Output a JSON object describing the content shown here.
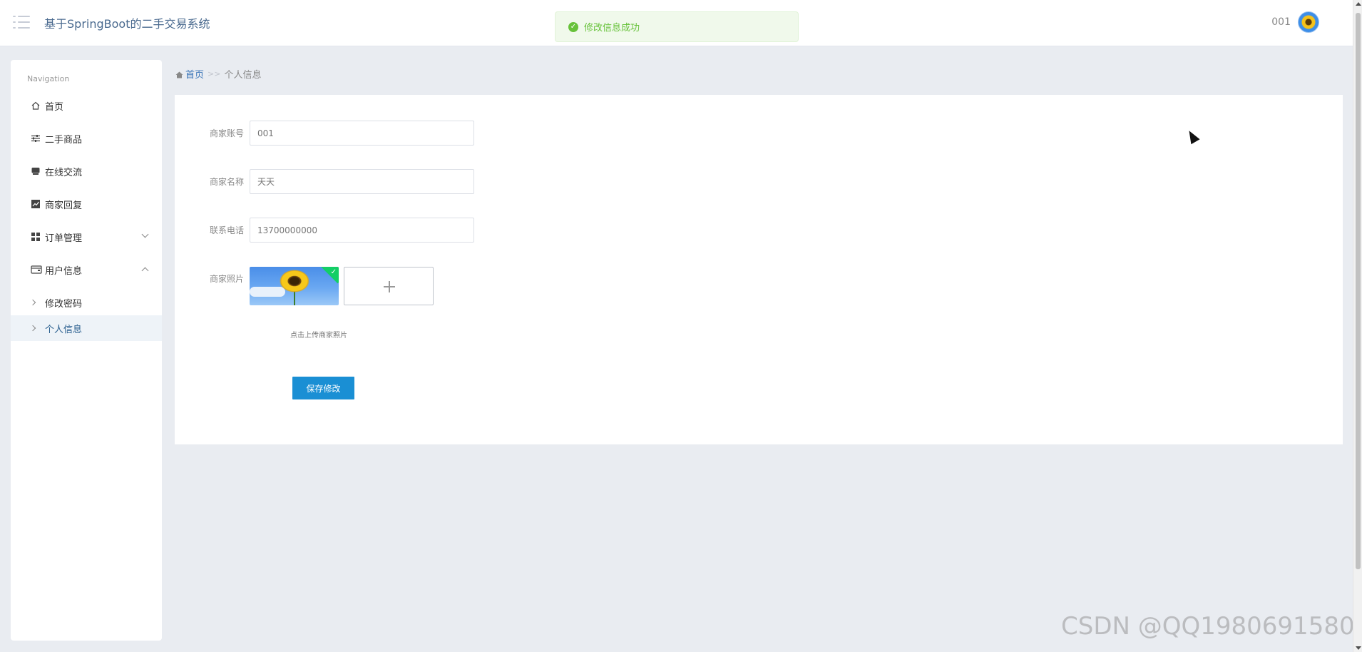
{
  "header": {
    "title": "基于SpringBoot的二手交易系统",
    "user_name": "001"
  },
  "toast": {
    "message": "修改信息成功",
    "color": "#67c23a"
  },
  "sidebar": {
    "heading": "Navigation",
    "items": [
      {
        "label": "首页",
        "icon": "home-icon"
      },
      {
        "label": "二手商品",
        "icon": "sliders-icon"
      },
      {
        "label": "在线交流",
        "icon": "chat-icon"
      },
      {
        "label": "商家回复",
        "icon": "chart-icon"
      },
      {
        "label": "订单管理",
        "icon": "grid-icon",
        "expanded": false
      },
      {
        "label": "用户信息",
        "icon": "wallet-icon",
        "expanded": true
      }
    ],
    "sub_items": [
      {
        "label": "修改密码",
        "active": false
      },
      {
        "label": "个人信息",
        "active": true
      }
    ]
  },
  "breadcrumb": {
    "home": "首页",
    "separator": ">>",
    "current": "个人信息"
  },
  "form": {
    "account_label": "商家账号",
    "account_value": "001",
    "name_label": "商家名称",
    "name_value": "天天",
    "phone_label": "联系电话",
    "phone_value": "13700000000",
    "photo_label": "商家照片",
    "upload_tip": "点击上传商家照片",
    "save_label": "保存修改"
  },
  "colors": {
    "accent": "#1a8fd4",
    "success": "#67c23a",
    "background": "#e9ecf1"
  },
  "watermark": "CSDN @QQ1980691580"
}
